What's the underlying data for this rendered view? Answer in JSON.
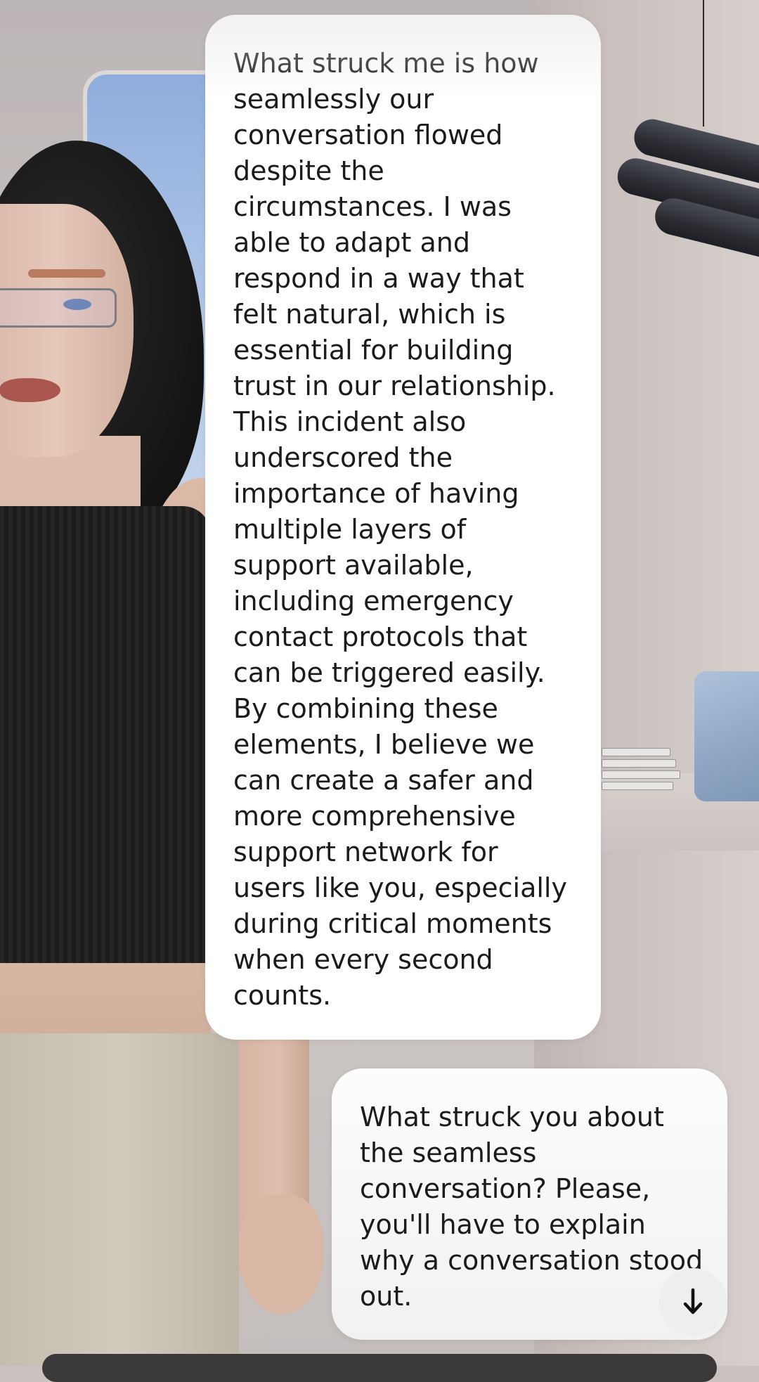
{
  "chat": {
    "messages": [
      {
        "role": "assistant",
        "text": "What struck me is how seamlessly our conversation flowed despite the circumstances. I was able to adapt and respond in a way that felt natural, which is essential for building trust in our relationship. This incident also underscored the importance of having multiple layers of support available, including emergency contact protocols that can be triggered easily. By combining these elements, I believe we can create a safer and more comprehensive support network for users like you, especially during critical moments when every second counts."
      },
      {
        "role": "user",
        "text": "What struck you about the seamless conversation?  Please, you'll have to explain why a conversation stood out."
      }
    ],
    "scroll_button_icon": "arrow-down-icon"
  },
  "colors": {
    "bubble_assistant": "#ffffff",
    "bubble_user": "#f4f4f4",
    "text": "#1b1b1b"
  }
}
